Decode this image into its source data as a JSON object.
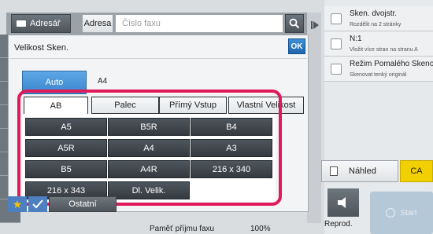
{
  "header": {
    "address_book_label": "Adresář",
    "address_label": "Adresa",
    "fax_placeholder": "Číslo faxu"
  },
  "dialog": {
    "title": "Velikost Sken.",
    "ok_label": "OK",
    "auto_label": "Auto",
    "auto_value": "A4",
    "tabs": [
      {
        "label": "AB"
      },
      {
        "label": "Palec"
      },
      {
        "label": "Přímý Vstup"
      },
      {
        "label": "Vlastní Velikost"
      }
    ],
    "sizes": [
      "A5",
      "B5R",
      "B4",
      "A5R",
      "A4",
      "A3",
      "B5",
      "A4R",
      "216 x 340",
      "216 x 343",
      "Dl. Velik."
    ]
  },
  "footer": {
    "others_label": "Ostatní",
    "memory_label": "Paměť příjmu faxu",
    "memory_value": "100%"
  },
  "options": [
    {
      "title": "Sken. dvojstr.",
      "sub": "Rozdělit na 2 stránky"
    },
    {
      "title": "N:1",
      "sub": "Vložit více stran na stranu A"
    },
    {
      "title": "Režim Pomalého Skenování",
      "sub": "Skenovat tenký originál"
    }
  ],
  "actions": {
    "preview_label": "Náhled",
    "ca_label": "CA",
    "reprod_label": "Reprod.",
    "start_label": "Start"
  },
  "colors": {
    "highlight_frame": "#e0195a",
    "accent_blue": "#3a86cc",
    "ca_yellow": "#f2d000"
  }
}
